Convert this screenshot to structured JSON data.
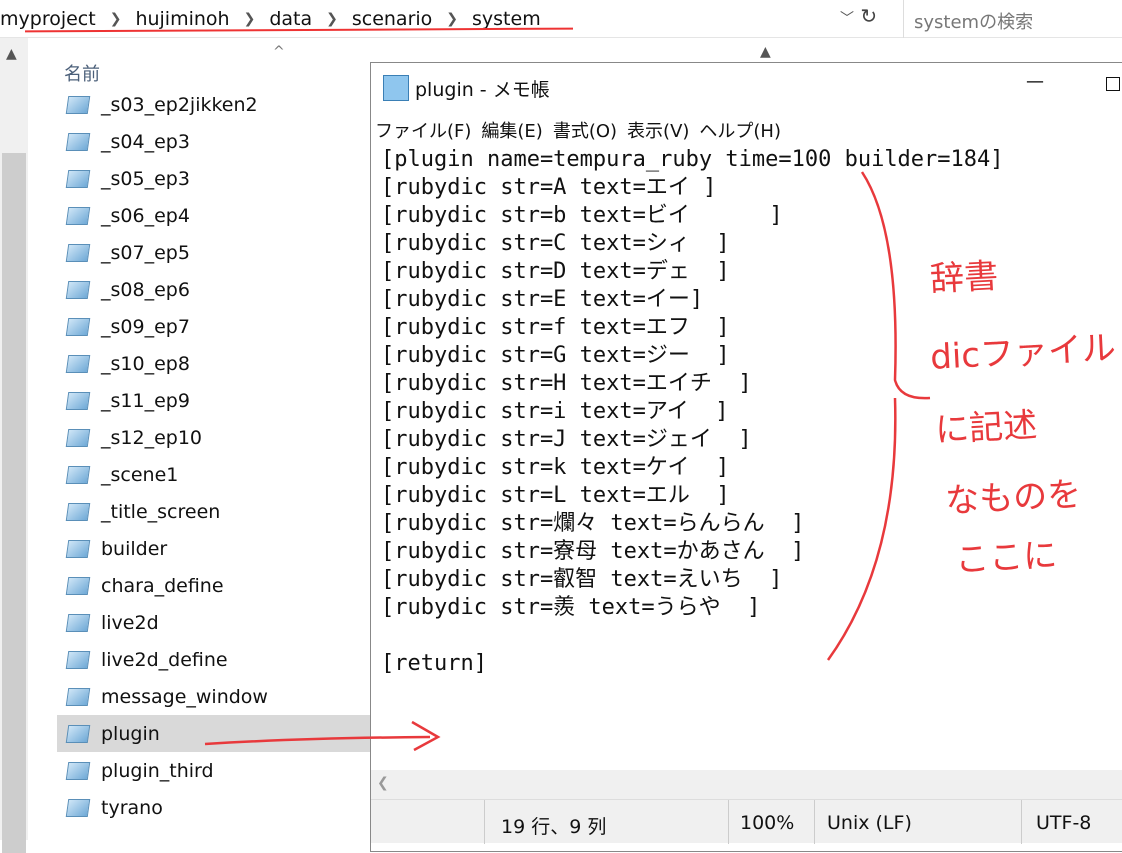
{
  "breadcrumb": [
    "myproject",
    "hujiminoh",
    "data",
    "scenario",
    "system"
  ],
  "search_placeholder": "systemの検索",
  "explorer": {
    "column_header": "名前",
    "files": [
      "_s03_ep2jikken2",
      "_s04_ep3",
      "_s05_ep3",
      "_s06_ep4",
      "_s07_ep5",
      "_s08_ep6",
      "_s09_ep7",
      "_s10_ep8",
      "_s11_ep9",
      "_s12_ep10",
      "_scene1",
      "_title_screen",
      "builder",
      "chara_define",
      "live2d",
      "live2d_define",
      "message_window",
      "plugin",
      "plugin_third",
      "tyrano"
    ],
    "selected": "plugin"
  },
  "notepad": {
    "title": "plugin - メモ帳",
    "menu": [
      "ファイル(F)",
      "編集(E)",
      "書式(O)",
      "表示(V)",
      "ヘルプ(H)"
    ],
    "lines": [
      "[plugin name=tempura_ruby time=100 builder=184]",
      "[rubydic str=A text=エイ ]",
      "[rubydic str=b text=ビイ      ]",
      "[rubydic str=C text=シィ  ]",
      "[rubydic str=D text=デェ  ]",
      "[rubydic str=E text=イー]",
      "[rubydic str=f text=エフ  ]",
      "[rubydic str=G text=ジー  ]",
      "[rubydic str=H text=エイチ  ]",
      "[rubydic str=i text=アイ  ]",
      "[rubydic str=J text=ジェイ  ]",
      "[rubydic str=k text=ケイ  ]",
      "[rubydic str=L text=エル  ]",
      "[rubydic str=爛々 text=らんらん  ]",
      "[rubydic str=寮母 text=かあさん  ]",
      "[rubydic str=叡智 text=えいち  ]",
      "[rubydic str=羨 text=うらや  ]",
      "",
      "[return]"
    ],
    "status": {
      "position": "19 行、9 列",
      "zoom": "100%",
      "eol": "Unix (LF)",
      "encoding": "UTF-8"
    }
  },
  "annotation": [
    "辞書",
    "dicファイル",
    "に記述",
    "なものを",
    "ここに"
  ],
  "colors": {
    "annotation": "#e8393c"
  }
}
